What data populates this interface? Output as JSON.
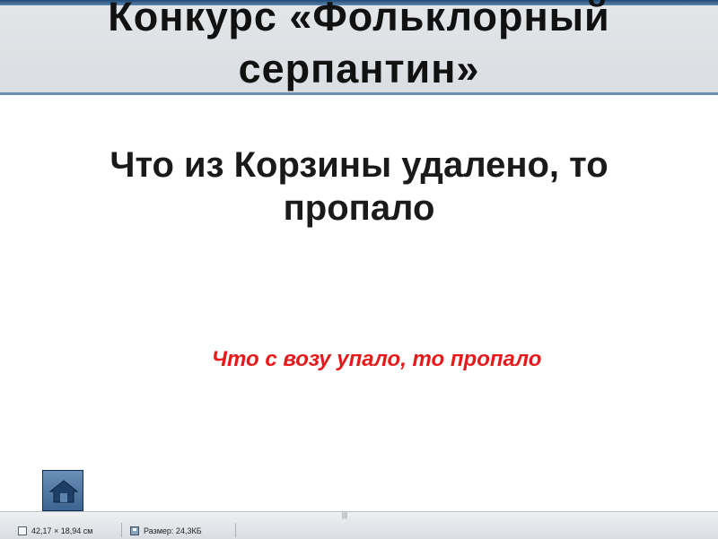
{
  "slide": {
    "title_lines": [
      "Конкурс «Фольклорный",
      "серпантин»"
    ],
    "question_lines": [
      "Что из Корзины удалено, то",
      "пропало"
    ],
    "answer": "Что с возу упало, то пропало",
    "answer_color": "#e8191b",
    "home_button_icon": "home-icon"
  },
  "status_bar": {
    "grip": "|||",
    "dimensions": "42,17 × 18,94 см",
    "dimensions_icon": "ruler-frame-icon",
    "size": "Размер: 24,3КБ",
    "size_icon": "floppy-disk-icon"
  },
  "colors": {
    "header_band": "#dadde1",
    "header_accent": "#1e4a78",
    "home_button": "#4f77a3"
  }
}
